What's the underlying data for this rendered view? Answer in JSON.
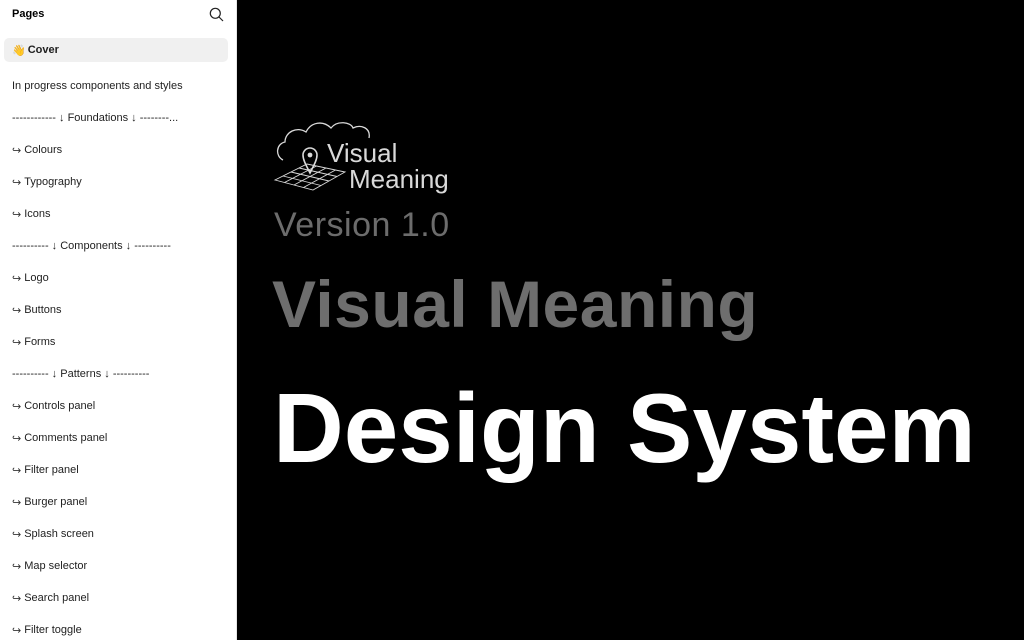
{
  "sidebar": {
    "title": "Pages",
    "search_icon": "search-icon",
    "pages": [
      {
        "label": "Cover",
        "emoji": "👋",
        "active": true
      },
      {
        "label": "In progress components and styles"
      },
      {
        "label": "------------ ↓ Foundations ↓ --------..."
      },
      {
        "label": "Colours",
        "arrow": "↪"
      },
      {
        "label": "Typography",
        "arrow": "↪"
      },
      {
        "label": "Icons",
        "arrow": "↪"
      },
      {
        "label": "---------- ↓ Components ↓ ----------"
      },
      {
        "label": "Logo",
        "arrow": "↪"
      },
      {
        "label": "Buttons",
        "arrow": "↪"
      },
      {
        "label": "Forms",
        "arrow": "↪"
      },
      {
        "label": "---------- ↓ Patterns ↓ ----------"
      },
      {
        "label": "Controls panel",
        "arrow": "↪"
      },
      {
        "label": "Comments panel",
        "arrow": "↪"
      },
      {
        "label": "Filter panel",
        "arrow": "↪"
      },
      {
        "label": "Burger panel",
        "arrow": "↪"
      },
      {
        "label": "Splash screen",
        "arrow": "↪"
      },
      {
        "label": "Map selector",
        "arrow": "↪"
      },
      {
        "label": "Search panel",
        "arrow": "↪"
      },
      {
        "label": "Filter toggle",
        "arrow": "↪"
      }
    ]
  },
  "canvas": {
    "logo": {
      "line1": "Visual",
      "line2": "Meaning"
    },
    "version": "Version 1.0",
    "product": "Visual Meaning",
    "headline": "Design System",
    "colors": {
      "background": "#000000",
      "muted_text": "#6e6e6e",
      "headline": "#ffffff",
      "logo": "#d9d9d9"
    }
  }
}
